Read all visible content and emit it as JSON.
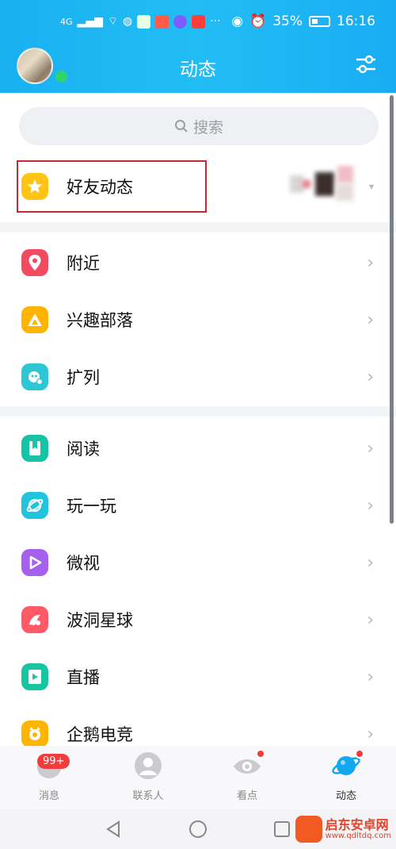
{
  "statusbar": {
    "signal": "4G",
    "battery": "35%",
    "time": "16:16",
    "more": "···"
  },
  "header": {
    "title": "动态"
  },
  "search": {
    "placeholder": "搜索"
  },
  "friend_feed": {
    "label": "好友动态"
  },
  "group1": [
    {
      "label": "附近",
      "icon": "location-pin-icon",
      "color": "#f24b5f"
    },
    {
      "label": "兴趣部落",
      "icon": "tribe-triangle-icon",
      "color": "#ffb400"
    },
    {
      "label": "扩列",
      "icon": "expand-friends-icon",
      "color": "#2cc7d2"
    }
  ],
  "group2": [
    {
      "label": "阅读",
      "icon": "book-icon",
      "color": "#16c3a6"
    },
    {
      "label": "玩一玩",
      "icon": "planet-game-icon",
      "color": "#22c4dd"
    },
    {
      "label": "微视",
      "icon": "play-icon",
      "color": "#a560f0"
    },
    {
      "label": "波洞星球",
      "icon": "bodong-icon",
      "color": "#ff5a66"
    },
    {
      "label": "直播",
      "icon": "live-icon",
      "color": "#17c6a0"
    },
    {
      "label": "企鹅电竞",
      "icon": "esports-icon",
      "color": "#ffb400"
    }
  ],
  "tabs": [
    {
      "label": "消息",
      "badge": "99+"
    },
    {
      "label": "联系人"
    },
    {
      "label": "看点"
    },
    {
      "label": "动态"
    }
  ],
  "watermark": {
    "name": "启东安卓网",
    "url": "www.qdltdq.com"
  },
  "colors": {
    "header": "#1eb6f2",
    "accent": "#12a8ef",
    "highlight": "#c8282f"
  }
}
